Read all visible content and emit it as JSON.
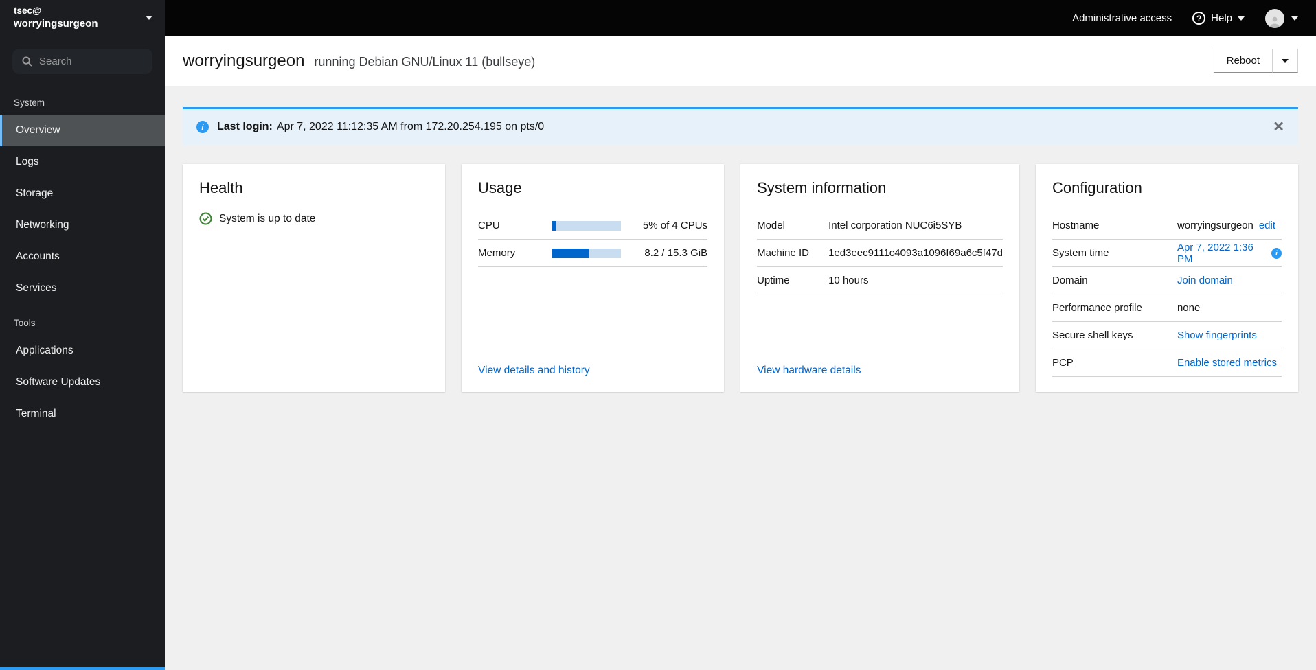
{
  "colors": {
    "link_blue": "#0066cc",
    "info_blue": "#2b9af3",
    "success_green": "#3e8635",
    "nav_selected_accent": "#73bcf7",
    "progress_fill": "#0066cc",
    "progress_track": "#c9ddf1"
  },
  "masthead": {
    "user": "tsec@",
    "host": "worryingsurgeon",
    "admin_access": "Administrative access",
    "help": "Help"
  },
  "sidebar": {
    "search_placeholder": "Search",
    "groups": [
      {
        "label": "System",
        "items": [
          {
            "label": "Overview"
          },
          {
            "label": "Logs"
          },
          {
            "label": "Storage"
          },
          {
            "label": "Networking"
          },
          {
            "label": "Accounts"
          },
          {
            "label": "Services"
          }
        ]
      },
      {
        "label": "Tools",
        "items": [
          {
            "label": "Applications"
          },
          {
            "label": "Software Updates"
          },
          {
            "label": "Terminal"
          }
        ]
      }
    ]
  },
  "page_header": {
    "title": "worryingsurgeon",
    "subtitle": "running Debian GNU/Linux 11 (bullseye)",
    "reboot": "Reboot"
  },
  "alert": {
    "title": "Last login:",
    "message": "Apr 7, 2022 11:12:35 AM from 172.20.254.195 on pts/0"
  },
  "health": {
    "title": "Health",
    "status": "System is up to date"
  },
  "usage": {
    "title": "Usage",
    "rows": [
      {
        "label": "CPU",
        "percent": 5,
        "value": "5% of 4 CPUs"
      },
      {
        "label": "Memory",
        "percent": 54,
        "value": "8.2 / 15.3 GiB"
      }
    ],
    "footer_link": "View details and history"
  },
  "system_information": {
    "title": "System information",
    "rows": [
      {
        "label": "Model",
        "value": "Intel corporation NUC6i5SYB"
      },
      {
        "label": "Machine ID",
        "value": "1ed3eec9111c4093a1096f69a6c5f47d"
      },
      {
        "label": "Uptime",
        "value": "10 hours"
      }
    ],
    "footer_link": "View hardware details"
  },
  "configuration": {
    "title": "Configuration",
    "hostname": {
      "label": "Hostname",
      "value": "worryingsurgeon",
      "action": "edit"
    },
    "system_time": {
      "label": "System time",
      "value": "Apr 7, 2022 1:36 PM"
    },
    "domain": {
      "label": "Domain",
      "link": "Join domain"
    },
    "performance_profile": {
      "label": "Performance profile",
      "value": "none"
    },
    "ssh_keys": {
      "label": "Secure shell keys",
      "link": "Show fingerprints"
    },
    "pcp": {
      "label": "PCP",
      "link": "Enable stored metrics"
    }
  }
}
